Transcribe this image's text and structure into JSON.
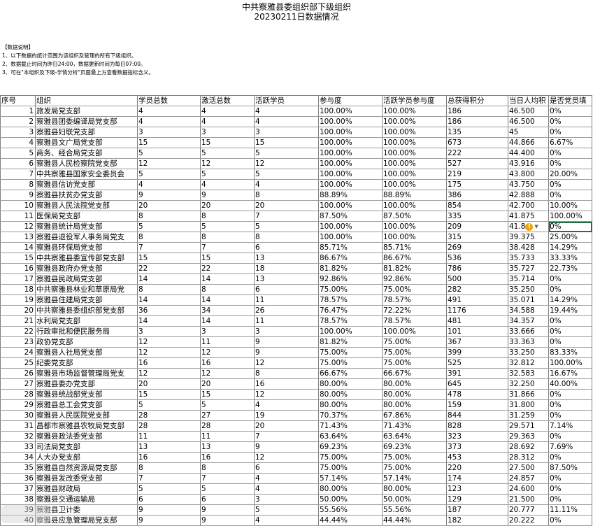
{
  "title": "中共察雅县委组织部下级组织",
  "subtitle": "20230211日数据情况",
  "notes": {
    "heading": "【数据说明】",
    "lines": [
      "1、以下数据的统计范围为该组织及管理的所有下级组织。",
      "2、数据截止时间为昨日24:00，数据更新时间为每日07:00。",
      "3、可在\"本组织及下级-学情分析\"页面最上方查看数据指标含义。"
    ]
  },
  "columns": [
    "序号",
    "组织",
    "学员总数",
    "激活总数",
    "活跃学员",
    "参与度",
    "活跃学员参与度",
    "总获得积分",
    "当日人均积",
    "是否党员填"
  ],
  "rows": [
    [
      "1",
      "旅发局党支部",
      "4",
      "4",
      "4",
      "100.00%",
      "100.00%",
      "186",
      "46.500",
      "0%"
    ],
    [
      "2",
      "察雅县团委编译局党支部",
      "4",
      "4",
      "4",
      "100.00%",
      "100.00%",
      "186",
      "46.500",
      "0%"
    ],
    [
      "3",
      "察雅县妇联党支部",
      "3",
      "3",
      "3",
      "100.00%",
      "100.00%",
      "135",
      "45",
      "0%"
    ],
    [
      "4",
      "察雅县文广局党支部",
      "15",
      "15",
      "15",
      "100.00%",
      "100.00%",
      "673",
      "44.866",
      "6.67%"
    ],
    [
      "5",
      "商务、经合局党支部",
      "5",
      "5",
      "5",
      "100.00%",
      "100.00%",
      "222",
      "44.400",
      "0%"
    ],
    [
      "6",
      "察雅县人民检察院党支部",
      "12",
      "12",
      "12",
      "100.00%",
      "100.00%",
      "527",
      "43.916",
      "0%"
    ],
    [
      "7",
      "中共察雅县国家安全委员会",
      "5",
      "5",
      "5",
      "100.00%",
      "100.00%",
      "219",
      "43.800",
      "20.00%"
    ],
    [
      "8",
      "察雅县信访党支部",
      "4",
      "4",
      "4",
      "100.00%",
      "100.00%",
      "175",
      "43.750",
      "0%"
    ],
    [
      "9",
      "察雅县扶贫办党支部",
      "9",
      "9",
      "8",
      "88.89%",
      "88.89%",
      "386",
      "42.888",
      "0%"
    ],
    [
      "10",
      "察雅县人民法院党支部",
      "20",
      "20",
      "20",
      "100.00%",
      "100.00%",
      "854",
      "42.700",
      "10.00%"
    ],
    [
      "11",
      "医保局党支部",
      "8",
      "8",
      "7",
      "87.50%",
      "87.50%",
      "335",
      "41.875",
      "100.00%"
    ],
    [
      "12",
      "察雅县统计局党支部",
      "5",
      "5",
      "5",
      "100.00%",
      "100.00%",
      "209",
      "41.8",
      "0%"
    ],
    [
      "13",
      "察雅县退役军人事务局党支",
      "8",
      "8",
      "8",
      "100.00%",
      "100.00%",
      "315",
      "39.375",
      "25.00%"
    ],
    [
      "14",
      "察雅县环保局党支部",
      "7",
      "7",
      "6",
      "85.71%",
      "85.71%",
      "269",
      "38.428",
      "14.29%"
    ],
    [
      "15",
      "中共察雅县委宣传部党支部",
      "15",
      "15",
      "13",
      "86.67%",
      "86.67%",
      "536",
      "35.733",
      "33.33%"
    ],
    [
      "16",
      "察雅县政府办党支部",
      "22",
      "22",
      "18",
      "81.82%",
      "81.82%",
      "786",
      "35.727",
      "22.73%"
    ],
    [
      "17",
      "察雅县民政局党支部",
      "14",
      "14",
      "13",
      "92.86%",
      "92.86%",
      "500",
      "35.714",
      "0%"
    ],
    [
      "18",
      "中共察雅县林业和草原局党",
      "8",
      "8",
      "6",
      "75.00%",
      "75.00%",
      "282",
      "35.250",
      "0%"
    ],
    [
      "19",
      "察雅县住建局党支部",
      "14",
      "14",
      "11",
      "78.57%",
      "78.57%",
      "491",
      "35.071",
      "14.29%"
    ],
    [
      "20",
      "中共察雅县委组织部党支部",
      "36",
      "34",
      "26",
      "76.47%",
      "72.22%",
      "1176",
      "34.588",
      "19.44%"
    ],
    [
      "21",
      "水利局党支部",
      "14",
      "14",
      "11",
      "78.57%",
      "78.57%",
      "481",
      "34.357",
      "0%"
    ],
    [
      "22",
      "行政审批和便民服务局",
      "3",
      "3",
      "3",
      "100.00%",
      "100.00%",
      "101",
      "33.666",
      "0%"
    ],
    [
      "23",
      "政协党支部",
      "12",
      "11",
      "9",
      "81.82%",
      "75.00%",
      "367",
      "33.363",
      "0%"
    ],
    [
      "24",
      "察雅县人社局党支部",
      "12",
      "12",
      "9",
      "75.00%",
      "75.00%",
      "399",
      "33.250",
      "83.33%"
    ],
    [
      "25",
      "纪委党支部",
      "16",
      "16",
      "12",
      "75.00%",
      "75.00%",
      "525",
      "32.812",
      "100.00%"
    ],
    [
      "26",
      "察雅县市场监督管理局党支",
      "12",
      "12",
      "8",
      "66.67%",
      "66.67%",
      "391",
      "32.583",
      "16.67%"
    ],
    [
      "27",
      "察雅县委办党支部",
      "20",
      "20",
      "16",
      "80.00%",
      "80.00%",
      "645",
      "32.250",
      "40.00%"
    ],
    [
      "28",
      "察雅县统战部党支部",
      "15",
      "15",
      "12",
      "80.00%",
      "80.00%",
      "478",
      "31.866",
      "0%"
    ],
    [
      "29",
      "察雅县总工会党支部",
      "5",
      "5",
      "4",
      "80.00%",
      "80.00%",
      "159",
      "31.800",
      "0%"
    ],
    [
      "30",
      "察雅县人民医院党支部",
      "28",
      "27",
      "19",
      "70.37%",
      "67.86%",
      "844",
      "31.259",
      "0%"
    ],
    [
      "31",
      "昌都市察雅县农牧局党支部",
      "28",
      "28",
      "20",
      "71.43%",
      "71.43%",
      "828",
      "29.571",
      "7.14%"
    ],
    [
      "32",
      "察雅县政法委党支部",
      "11",
      "11",
      "7",
      "63.64%",
      "63.64%",
      "323",
      "29.363",
      "0%"
    ],
    [
      "33",
      "司法局党支部",
      "13",
      "13",
      "9",
      "69.23%",
      "69.23%",
      "373",
      "28.692",
      "7.69%"
    ],
    [
      "34",
      "人大办党支部",
      "16",
      "16",
      "12",
      "75.00%",
      "75.00%",
      "453",
      "28.312",
      "0%"
    ],
    [
      "35",
      "察雅县自然资源局党支部",
      "8",
      "8",
      "6",
      "75.00%",
      "75.00%",
      "220",
      "27.500",
      "87.50%"
    ],
    [
      "36",
      "察雅县发改委党支部",
      "7",
      "7",
      "4",
      "57.14%",
      "57.14%",
      "174",
      "24.857",
      "0%"
    ],
    [
      "37",
      "察雅县财政局",
      "5",
      "5",
      "4",
      "80.00%",
      "80.00%",
      "123",
      "24.600",
      "0%"
    ],
    [
      "38",
      "察雅县交通运输局",
      "6",
      "6",
      "3",
      "50.00%",
      "50.00%",
      "129",
      "21.500",
      "0%"
    ],
    [
      "39",
      "察雅县卫计委",
      "9",
      "9",
      "5",
      "55.56%",
      "55.56%",
      "187",
      "20.777",
      "11.11%"
    ],
    [
      "40",
      "察雅县应急管理局党支部",
      "9",
      "9",
      "4",
      "44.44%",
      "44.44%",
      "182",
      "20.222",
      "0%"
    ]
  ],
  "warn_icon": "warning-icon",
  "accent": "#1e7145"
}
